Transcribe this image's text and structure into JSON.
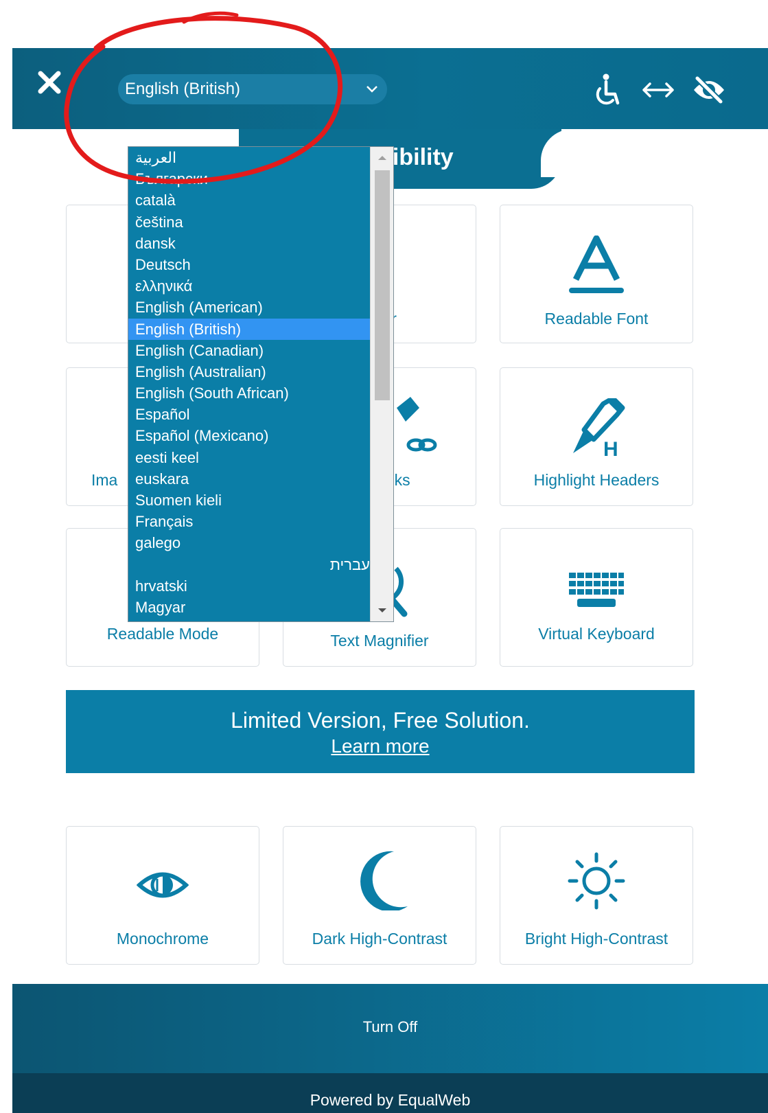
{
  "header": {
    "selected_language": "English (British)"
  },
  "tab": {
    "label_visible": "sibility"
  },
  "cards": {
    "magnifier_visible": "nifier",
    "readable_font": "Readable Font",
    "images_visible": "Ima",
    "highlight_links_visible": "nt Links",
    "highlight_headers": "Highlight Headers",
    "readable_mode": "Readable Mode",
    "text_magnifier": "Text Magnifier",
    "virtual_keyboard": "Virtual Keyboard",
    "monochrome": "Monochrome",
    "dark_high_contrast": "Dark High-Contrast",
    "bright_high_contrast": "Bright High-Contrast"
  },
  "promo": {
    "title": "Limited Version, Free Solution.",
    "link": "Learn more"
  },
  "footer": {
    "turn_off": "Turn Off",
    "powered_by_visible": "Powered by EqualWeb"
  },
  "language_options": [
    "العربية",
    "Български",
    "català",
    "čeština",
    "dansk",
    "Deutsch",
    "ελληνικά",
    "English (American)",
    "English (British)",
    "English (Canadian)",
    "English (Australian)",
    "English (South African)",
    "Español",
    "Español (Mexicano)",
    "eesti keel",
    "euskara",
    "Suomen kieli",
    "Français",
    "galego",
    "עברית",
    "hrvatski",
    "Magyar"
  ],
  "colors": {
    "brand": "#0b7ea7",
    "header_dark": "#0c5f7e",
    "selected_option": "#3294f2",
    "annotation_red": "#e31b1b"
  },
  "icons": [
    "close-icon",
    "chevron-down-icon",
    "accessibility-person-icon",
    "horizontal-arrows-icon",
    "eye-slash-icon"
  ]
}
